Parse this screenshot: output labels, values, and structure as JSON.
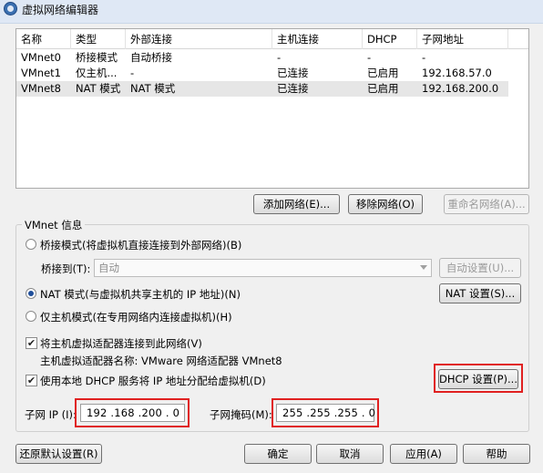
{
  "window": {
    "title": "虚拟网络编辑器"
  },
  "table": {
    "headers": [
      "名称",
      "类型",
      "外部连接",
      "主机连接",
      "DHCP",
      "子网地址"
    ],
    "rows": [
      [
        "VMnet0",
        "桥接模式",
        "自动桥接",
        "-",
        "-",
        "-"
      ],
      [
        "VMnet1",
        "仅主机...",
        "-",
        "已连接",
        "已启用",
        "192.168.57.0"
      ],
      [
        "VMnet8",
        "NAT 模式",
        "NAT 模式",
        "已连接",
        "已启用",
        "192.168.200.0"
      ]
    ],
    "selected_row": 2
  },
  "table_buttons": {
    "add": "添加网络(E)...",
    "remove": "移除网络(O)",
    "rename": "重命名网络(A)..."
  },
  "vmnet_info": {
    "title": "VMnet 信息",
    "bridged_label": "桥接模式(将虚拟机直接连接到外部网络)(B)",
    "bridge_to_label": "桥接到(T):",
    "bridge_to_value": "自动",
    "auto_settings": "自动设置(U)...",
    "nat_label": "NAT 模式(与虚拟机共享主机的 IP 地址)(N)",
    "nat_settings": "NAT 设置(S)...",
    "hostonly_label": "仅主机模式(在专用网络内连接虚拟机)(H)",
    "connect_adapter_label": "将主机虚拟适配器连接到此网络(V)",
    "adapter_name_text": "主机虚拟适配器名称: VMware 网络适配器 VMnet8",
    "dhcp_label": "使用本地 DHCP 服务将 IP 地址分配给虚拟机(D)",
    "dhcp_settings": "DHCP 设置(P)...",
    "subnet_ip_label": "子网 IP (I):",
    "subnet_ip_value": "192 .168 .200 . 0",
    "subnet_mask_label": "子网掩码(M):",
    "subnet_mask_value": "255 .255 .255 . 0",
    "selected_mode": "nat",
    "connect_adapter_checked": true,
    "dhcp_checked": true
  },
  "footer": {
    "restore": "还原默认设置(R)",
    "ok": "确定",
    "cancel": "取消",
    "apply": "应用(A)",
    "help": "帮助"
  },
  "colors": {
    "highlight_box": "#e02020",
    "selected_row": "#e6e6e6"
  }
}
